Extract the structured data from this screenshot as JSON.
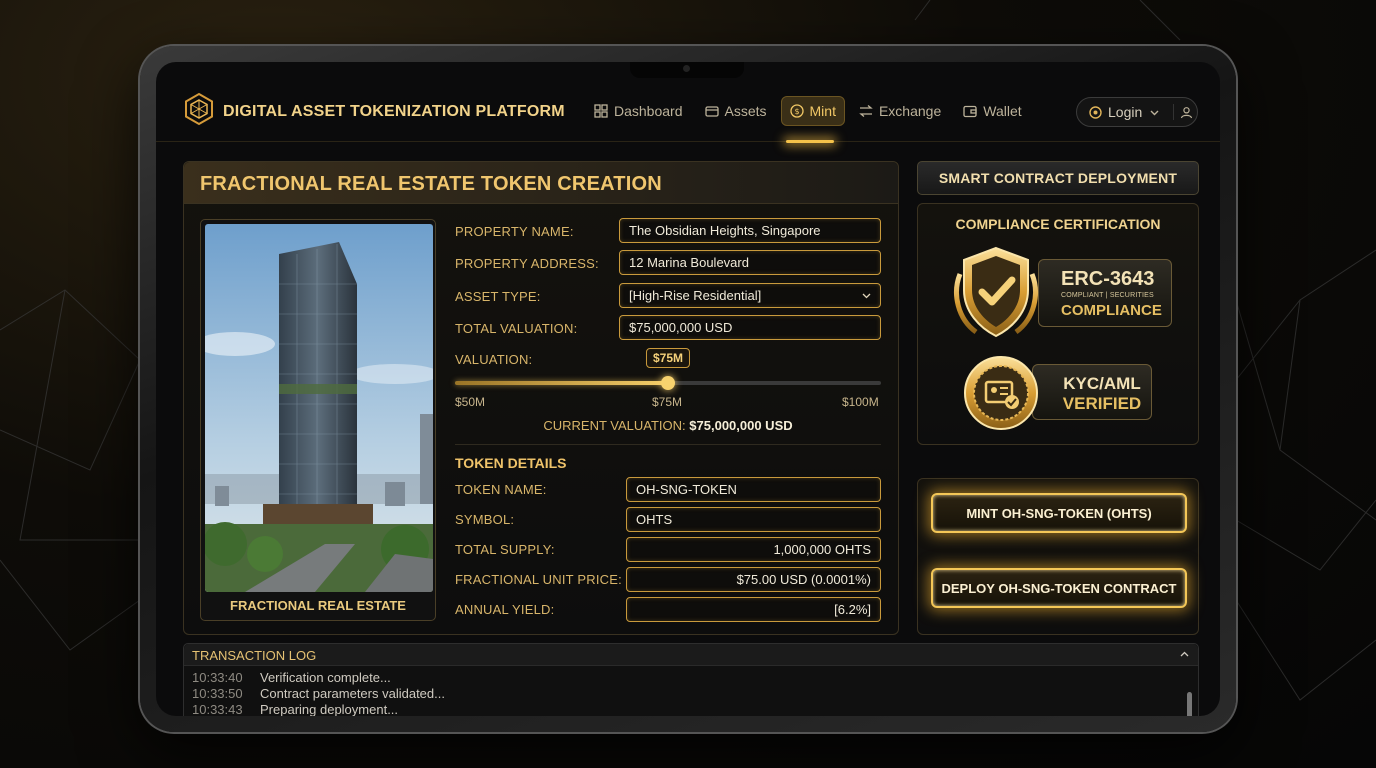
{
  "header": {
    "brand": "DIGITAL ASSET TOKENIZATION PLATFORM",
    "nav": [
      {
        "label": "Dashboard",
        "icon": "grid-icon"
      },
      {
        "label": "Assets",
        "icon": "wallet-card-icon"
      },
      {
        "label": "Mint",
        "icon": "coin-icon",
        "active": true
      },
      {
        "label": "Exchange",
        "icon": "swap-arrows-icon"
      },
      {
        "label": "Wallet",
        "icon": "wallet-icon"
      }
    ],
    "login_label": "Login"
  },
  "creation": {
    "title": "FRACTIONAL REAL ESTATE TOKEN CREATION",
    "photo_caption": "FRACTIONAL REAL ESTATE",
    "property_name_label": "PROPERTY NAME:",
    "property_name_value": "The Obsidian Heights, Singapore",
    "property_address_label": "PROPERTY ADDRESS:",
    "property_address_value": "12 Marina Boulevard",
    "asset_type_label": "ASSET TYPE:",
    "asset_type_value": "[High-Rise Residential]",
    "total_valuation_label": "TOTAL VALUATION:",
    "total_valuation_value": "$75,000,000 USD",
    "valuation_label": "VALUATION:",
    "slider": {
      "min_label": "$50M",
      "mid_label": "$75M",
      "max_label": "$100M",
      "bubble": "$75M",
      "min": 50,
      "max": 100,
      "value": 75
    },
    "current_valuation_label": "CURRENT VALUATION:",
    "current_valuation_value": "$75,000,000 USD",
    "token_details_title": "TOKEN DETAILS",
    "token_name_label": "TOKEN NAME:",
    "token_name_value": "OH-SNG-TOKEN",
    "symbol_label": "SYMBOL:",
    "symbol_value": "OHTS",
    "total_supply_label": "TOTAL SUPPLY:",
    "total_supply_value": "1,000,000 OHTS",
    "unit_price_label": "FRACTIONAL UNIT PRICE:",
    "unit_price_value": "$75.00 USD (0.0001%)",
    "annual_yield_label": "ANNUAL YIELD:",
    "annual_yield_value": "[6.2%]"
  },
  "compliance": {
    "deploy_header": "SMART CONTRACT DEPLOYMENT",
    "title": "COMPLIANCE CERTIFICATION",
    "erc_big": "ERC-3643",
    "erc_small": "COMPLIANT | SECURITIES",
    "erc_compliance": "COMPLIANCE",
    "kyc_line1": "KYC/AML",
    "kyc_line2": "VERIFIED"
  },
  "actions": {
    "mint_label": "MINT OH-SNG-TOKEN (OHTS)",
    "deploy_label": "DEPLOY OH-SNG-TOKEN CONTRACT"
  },
  "log": {
    "title": "TRANSACTION LOG",
    "entries": [
      {
        "time": "10:33:40",
        "message": "Verification complete..."
      },
      {
        "time": "10:33:50",
        "message": "Contract parameters validated..."
      },
      {
        "time": "10:33:43",
        "message": "Preparing deployment..."
      }
    ]
  },
  "colors": {
    "accent_gold": "#f0c66e",
    "glow_gold": "#f4c757",
    "background": "#0b0b0c"
  }
}
